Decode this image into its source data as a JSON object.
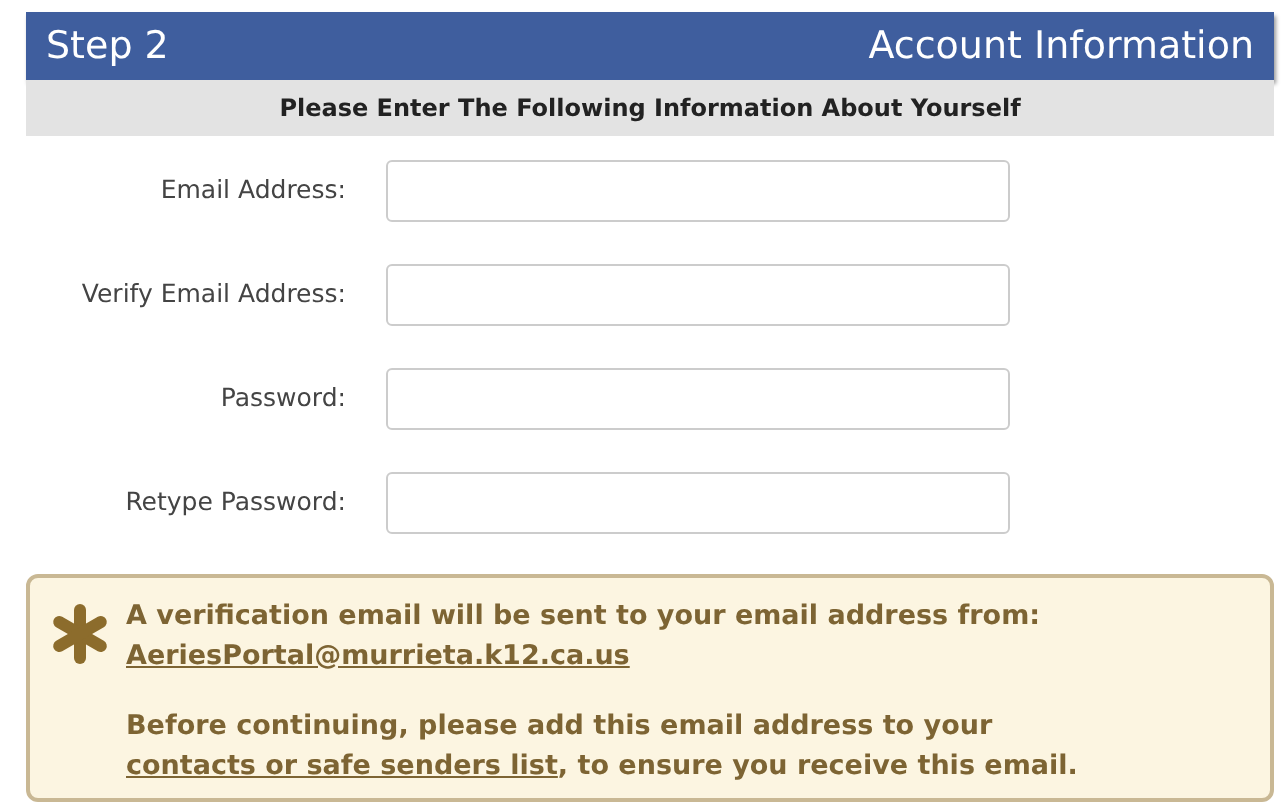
{
  "header": {
    "step": "Step 2",
    "title": "Account Information"
  },
  "subheader": "Please Enter The Following Information About Yourself",
  "fields": [
    {
      "label": "Email Address:"
    },
    {
      "label": "Verify Email Address:"
    },
    {
      "label": "Password:"
    },
    {
      "label": "Retype Password:"
    }
  ],
  "notice": {
    "intro": "A verification email will be sent to your email address from:",
    "email": "AeriesPortal@murrieta.k12.ca.us",
    "before": "Before continuing, please add this email address to your",
    "link": "contacts or safe senders list",
    "after": ", to ensure you receive this email."
  }
}
